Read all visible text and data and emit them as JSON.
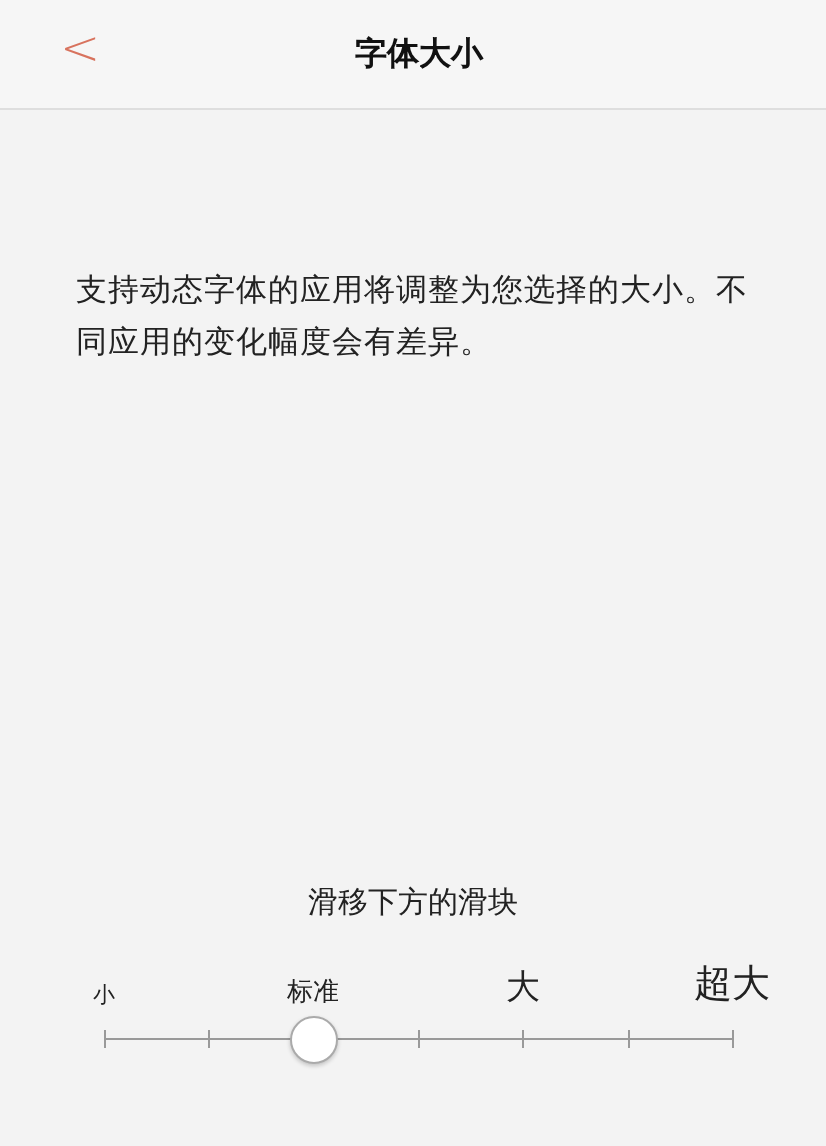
{
  "header": {
    "back": "<",
    "title": "字体大小"
  },
  "description": "支持动态字体的应用将调整为您选择的大小。不同应用的变化幅度会有差异。",
  "hint": "滑移下方的滑块",
  "slider": {
    "labels": [
      "小",
      "标准",
      "大",
      "超大"
    ],
    "level": 0.333
  }
}
